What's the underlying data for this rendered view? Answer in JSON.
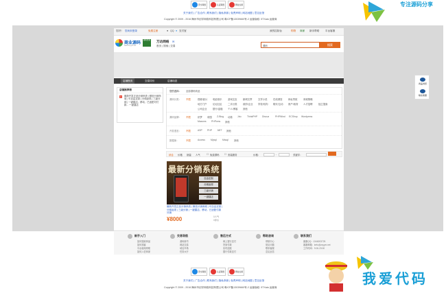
{
  "top_links": "关于我们 | 广告合作 | 联系我们 | 隐私条款 | 免责声明 | 网站地图 | 意见反馈",
  "copyright": "Copyright © 2009 - 2016 梅州市创宇网络科技有限公司 粤ICP备13039660号-2 运营版权: 5TXaia 运营商",
  "badges": [
    {
      "label": "安全联盟",
      "color": "#1e88e5"
    },
    {
      "label": "认证联盟",
      "color": "#e53935"
    },
    {
      "label": "网址信用",
      "color": "#e53935"
    }
  ],
  "topbar": {
    "welcome": "您好！",
    "login": "您尚未登录",
    "register": "免费注册",
    "qq": "QQ",
    "alipay": "支付宝",
    "member_center": "我的控制台",
    "shopping": "购物",
    "merchant": "商家",
    "help": "新手帮助",
    "contact": "平台客服"
  },
  "logo": {
    "text": "商业源码",
    "sub": "www.zzyym.net",
    "tag": "源码交易"
  },
  "category_label": "万达网络",
  "nav_mini": [
    "首页",
    "搜索",
    "交易"
  ],
  "search": {
    "placeholder": "源码",
    "button": "搜索"
  },
  "tabs": [
    "店铺首页",
    "交易评价",
    "店铺动态"
  ],
  "side": {
    "title": "店铺推荐榜",
    "num": "1",
    "text": "最新开发正品分销系统 | 微信分销商城 | 可自由定制 | 分佣返现 | 三级分销 | 一键建店，移动，已适配可付款... 一键建店"
  },
  "filter": {
    "breadcrumb_label": "您的选择：",
    "breadcrumb_value": "全部源码商品",
    "rows": [
      {
        "label": "源码分类：",
        "all": "不限",
        "opts": [
          "视频/影片",
          "电影音乐",
          "游戏交友",
          "新闻文章",
          "文学小说",
          "在线调查",
          "网址导航",
          "商城策略",
          "地方门户",
          "论坛社区",
          "二手分类",
          "政府/企业",
          "学校/机构",
          "聊天/互动",
          "房产/政府",
          "人才招聘",
          "独立搜索",
          "公司企业",
          "银行/金融",
          "个人/博客",
          "其他"
        ]
      },
      {
        "label": "源码品牌：",
        "all": "不限",
        "opts": [
          "织梦",
          "帝国",
          "Z-Blog",
          "动易",
          "Jdu",
          "ThinkPHP",
          "Discuz",
          "PHPWind",
          "ECShop",
          "Wordpress",
          "Maxcms",
          "PHPcms",
          "其他"
        ]
      },
      {
        "label": "开发语言：",
        "all": "不限",
        "opts": [
          "ASP",
          "PHP",
          ".NET",
          "其他"
        ]
      },
      {
        "label": "数据库：",
        "all": "不限",
        "opts": [
          "Access",
          "Mysql",
          "Mssql",
          "其他"
        ]
      }
    ]
  },
  "sortbar": {
    "items": [
      "综合",
      "价格",
      "销量",
      "人气"
    ],
    "checkbox_free": "免费源码",
    "checkbox_installed": "安装服务",
    "price_label": "价格：",
    "keyword_label": "关键字："
  },
  "product": {
    "banner_text": "最新分销系统",
    "buttons": [
      "自由定制",
      "分佣返现",
      "三级分销",
      "一键建店"
    ],
    "title": "最新开发正品分销系统 | 微信分销商城 | 可自由定制 | 分佣返现 | 三级分销 | 一键建店，移动，已适配付款分销",
    "price": "¥8000",
    "stats": [
      "0人气",
      "0评价"
    ]
  },
  "float_nav": [
    {
      "label": "商品浏览"
    },
    {
      "label": "联系客服"
    }
  ],
  "footer_cols": [
    {
      "title": "新手入门",
      "items": [
        "如何搜索商品",
        "如何找客",
        "平台使用帮助",
        "如何入驻商家"
      ]
    },
    {
      "title": "交易导航",
      "items": [
        "源码新书",
        "网站交易",
        "域名市场",
        "任务大厅"
      ]
    },
    {
      "title": "售后方式",
      "items": [
        "网上银行支付",
        "货到付款",
        "实时结账",
        "银行付款支付"
      ]
    },
    {
      "title": "帮助咨询",
      "items": [
        "帮助中心",
        "常见问题",
        "联系客服",
        "意见反馈"
      ]
    },
    {
      "title": "联系我们",
      "items": [
        "客服QQ：1346203725",
        "客服邮箱：kefu@zzyym.net",
        "工作时间：9:00-23:00"
      ]
    }
  ],
  "watermark_top": "专注源码分享",
  "watermark_bottom": "我爱代码",
  "brand_colors": {
    "accent": "#e2691f",
    "link": "#3366cc",
    "dark_tab": "#3b3b3b"
  }
}
